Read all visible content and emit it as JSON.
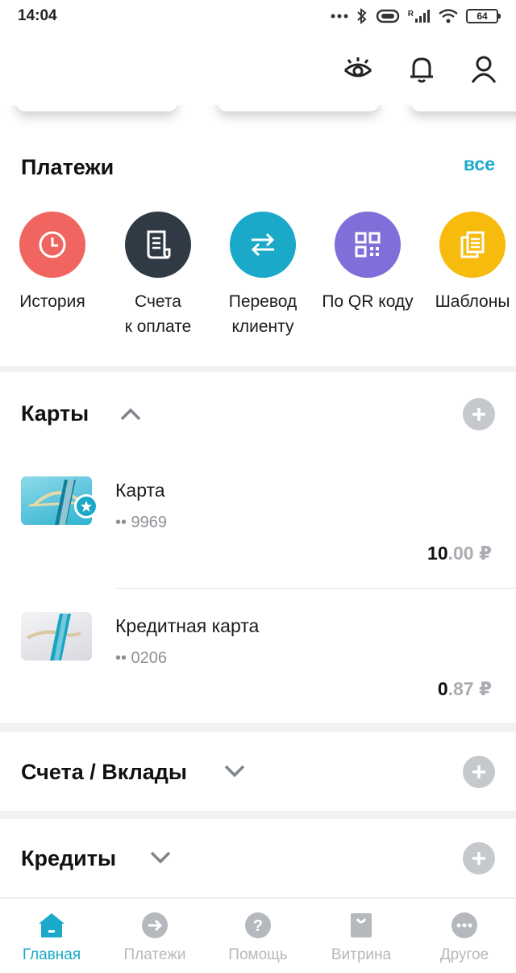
{
  "status_bar": {
    "time": "14:04",
    "battery": "64",
    "network_label": "R"
  },
  "payments": {
    "title": "Платежи",
    "all_link": "все",
    "actions": [
      {
        "label": "История",
        "icon": "clock-icon",
        "color": "#f06560"
      },
      {
        "label": "Счета\nк оплате",
        "icon": "invoice-icon",
        "color": "#2f3a45"
      },
      {
        "label": "Перевод\nклиенту",
        "icon": "transfer-arrows-icon",
        "color": "#1aa9c8"
      },
      {
        "label": "По QR коду",
        "icon": "qr-code-icon",
        "color": "#7f6fd8"
      },
      {
        "label": "Шаблоны",
        "icon": "templates-icon",
        "color": "#f7bb0e"
      }
    ]
  },
  "cards": {
    "title": "Карты",
    "items": [
      {
        "name": "Карта",
        "number": "•• 9969",
        "balance_int": "10",
        "balance_frac": ".00 ₽"
      },
      {
        "name": "Кредитная карта",
        "number": "•• 0206",
        "balance_int": "0",
        "balance_frac": ".87 ₽"
      }
    ]
  },
  "accounts": {
    "title": "Счета / Вклады"
  },
  "credits": {
    "title": "Кредиты"
  },
  "bottom_nav": [
    {
      "label": "Главная",
      "icon": "home-icon",
      "active": true
    },
    {
      "label": "Платежи",
      "icon": "arrow-circle-icon",
      "active": false
    },
    {
      "label": "Помощь",
      "icon": "help-icon",
      "active": false
    },
    {
      "label": "Витрина",
      "icon": "shopping-bag-icon",
      "active": false
    },
    {
      "label": "Другое",
      "icon": "more-dots-icon",
      "active": false
    }
  ],
  "colors": {
    "accent": "#1aa9c8",
    "inactive": "#b5b8bc",
    "plus_button": "#c5c8cc"
  }
}
